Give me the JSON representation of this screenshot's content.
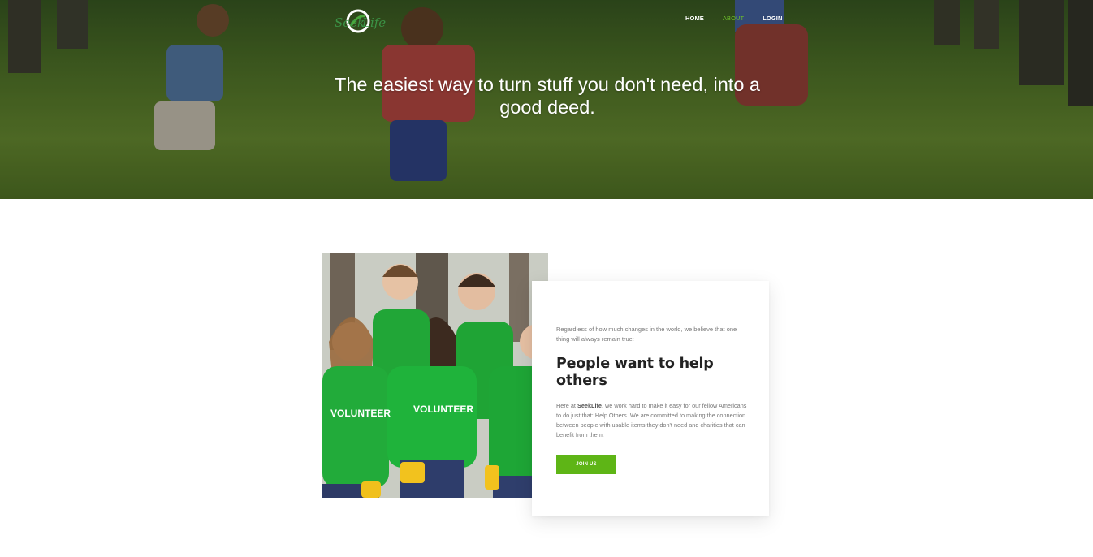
{
  "header": {
    "logo_text": "SeekLife",
    "nav": [
      {
        "label": "HOME",
        "active": false
      },
      {
        "label": "ABOUT",
        "active": true
      },
      {
        "label": "LOGIN",
        "active": false
      }
    ],
    "hero_title": "The easiest way to turn stuff you don't need, into a good deed."
  },
  "about": {
    "intro": "Regardless of how much changes in the world, we believe that one thing will always remain true:",
    "heading": "People want to help others",
    "body_prefix": "Here at ",
    "brand": "SeekLife",
    "body_suffix": ", we work hard to make it easy for our fellow Americans to do just that: Help Others. We are committed to making the connection between people with usable items they don't need and charities that can benefit from them.",
    "button_label": "JOIN US",
    "shirt_text": "VOLUNTEER"
  },
  "colors": {
    "accent": "#5eb516",
    "nav_active": "#6dbf2a",
    "heading": "#222222",
    "body_text": "#777777"
  }
}
